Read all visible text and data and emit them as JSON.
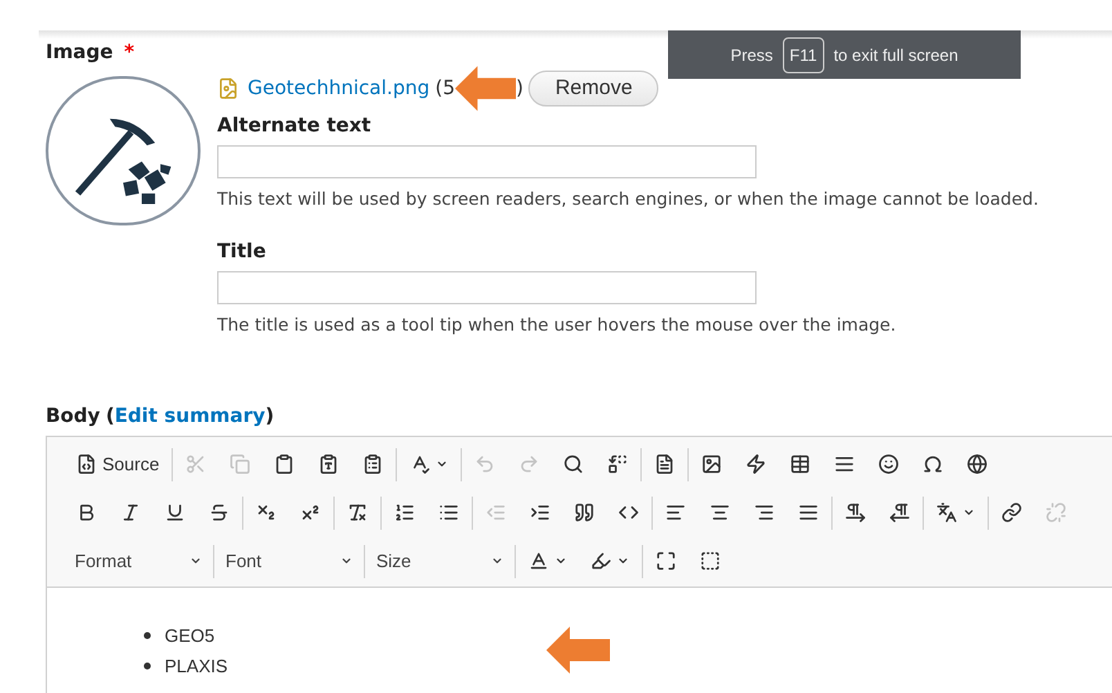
{
  "fullscreen_notice": {
    "before": "Press",
    "key": "F11",
    "after": "to exit full screen"
  },
  "image_field": {
    "label": "Image",
    "required": true,
    "required_mark": "*",
    "file_name": "Geotechhnical.png",
    "file_size_start": "(5",
    "file_size_end": ")",
    "remove_button": "Remove"
  },
  "alternate_text": {
    "label": "Alternate text",
    "help": "This text will be used by screen readers, search engines, or when the image cannot be loaded."
  },
  "title_field": {
    "label": "Title",
    "help": "The title is used as a tool tip when the user hovers the mouse over the image."
  },
  "body": {
    "label": "Body",
    "link_open": "(",
    "link": "Edit summary",
    "link_close": ")"
  },
  "toolbar_rows": [
    [
      [
        {
          "label": "Source",
          "disabled": false,
          "dropdown": false
        }
      ],
      [
        {
          "disabled": true,
          "dropdown": false
        },
        {
          "disabled": true,
          "dropdown": false
        },
        {
          "disabled": false,
          "dropdown": false
        },
        {
          "disabled": false,
          "dropdown": false
        },
        {
          "disabled": false,
          "dropdown": false
        }
      ],
      [
        {
          "disabled": false,
          "dropdown": true
        }
      ],
      [
        {
          "disabled": true,
          "dropdown": false
        },
        {
          "disabled": true,
          "dropdown": false
        },
        {
          "disabled": false,
          "dropdown": false
        },
        {
          "disabled": false,
          "dropdown": false
        }
      ],
      [
        {
          "disabled": false,
          "dropdown": false
        }
      ],
      [
        {
          "disabled": false,
          "dropdown": false
        },
        {
          "disabled": false,
          "dropdown": false
        },
        {
          "disabled": false,
          "dropdown": false
        },
        {
          "disabled": false,
          "dropdown": false
        },
        {
          "disabled": false,
          "dropdown": false
        },
        {
          "disabled": false,
          "dropdown": false
        },
        {
          "disabled": false,
          "dropdown": false
        }
      ]
    ],
    [
      [
        {
          "disabled": false,
          "dropdown": false
        },
        {
          "disabled": false,
          "dropdown": false
        },
        {
          "disabled": false,
          "dropdown": false
        },
        {
          "disabled": false,
          "dropdown": false
        }
      ],
      [
        {
          "disabled": false,
          "dropdown": false
        },
        {
          "disabled": false,
          "dropdown": false
        }
      ],
      [
        {
          "disabled": false,
          "dropdown": false
        }
      ],
      [
        {
          "disabled": false,
          "dropdown": false
        },
        {
          "disabled": false,
          "dropdown": false
        }
      ],
      [
        {
          "disabled": true,
          "dropdown": false
        },
        {
          "disabled": false,
          "dropdown": false
        },
        {
          "disabled": false,
          "dropdown": false
        },
        {
          "disabled": false,
          "dropdown": false
        }
      ],
      [
        {
          "disabled": false,
          "dropdown": false
        },
        {
          "disabled": false,
          "dropdown": false
        },
        {
          "disabled": false,
          "dropdown": false
        },
        {
          "disabled": false,
          "dropdown": false
        }
      ],
      [
        {
          "disabled": false,
          "dropdown": false
        },
        {
          "disabled": false,
          "dropdown": false
        }
      ],
      [
        {
          "disabled": false,
          "dropdown": true
        }
      ],
      [
        {
          "disabled": false,
          "dropdown": false
        },
        {
          "disabled": true,
          "dropdown": false
        }
      ]
    ]
  ],
  "combos": [
    {
      "label": "Format"
    },
    {
      "label": "Font"
    },
    {
      "label": "Size"
    }
  ],
  "toolbar_row3": [
    [
      {
        "disabled": false,
        "dropdown": true
      },
      {
        "disabled": false,
        "dropdown": true
      }
    ],
    [
      {
        "disabled": false,
        "dropdown": false
      },
      {
        "disabled": false,
        "dropdown": false
      }
    ]
  ],
  "content_list": [
    "GEO5",
    "PLAXIS"
  ]
}
